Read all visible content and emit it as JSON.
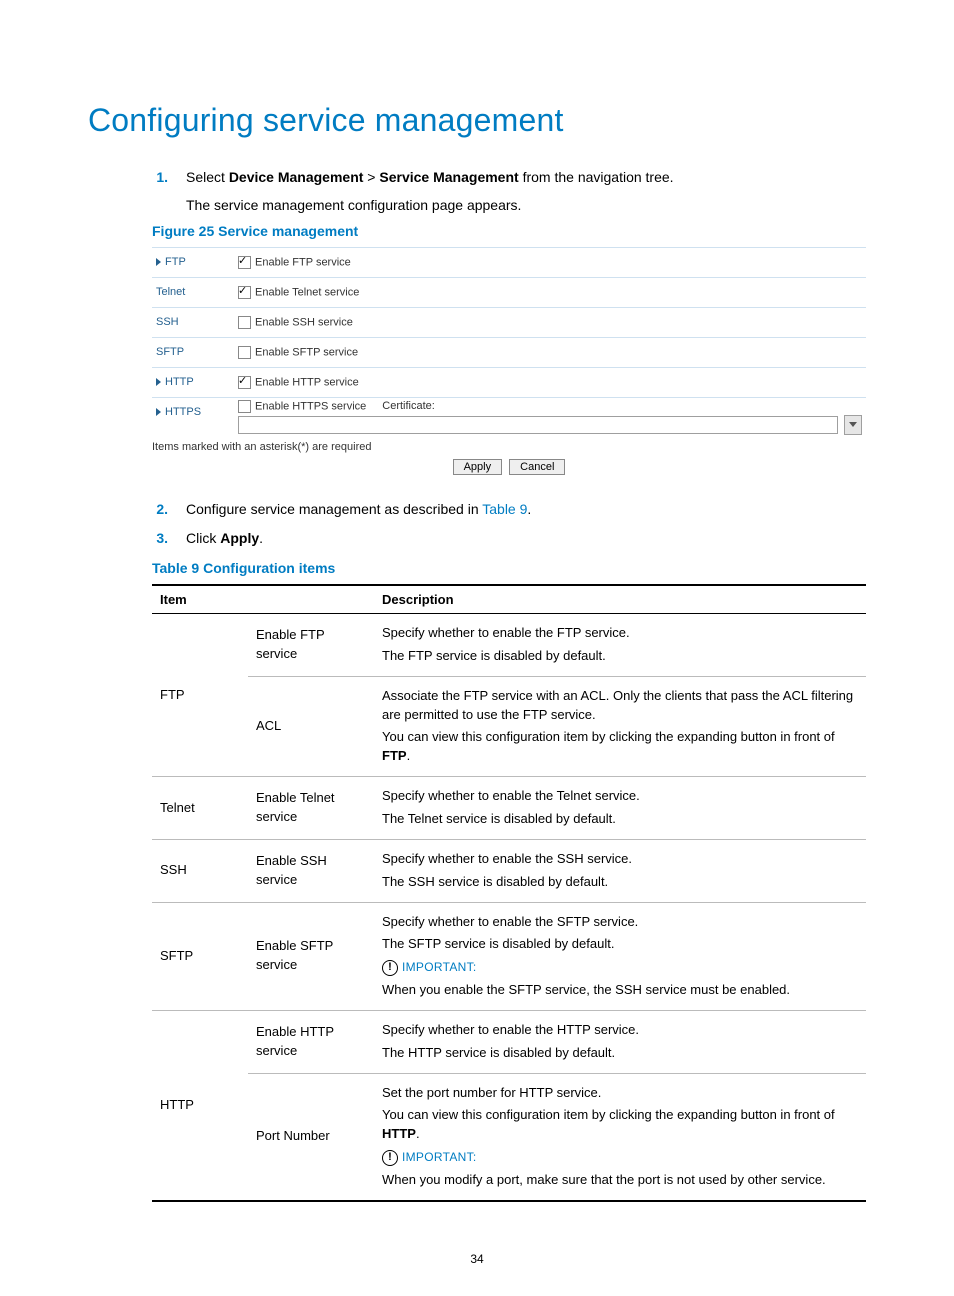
{
  "title": "Configuring service management",
  "steps": {
    "s1_num": "1.",
    "s1_a": "Select ",
    "s1_b": "Device Management",
    "s1_c": " > ",
    "s1_d": "Service Management",
    "s1_e": " from the navigation tree.",
    "s1_sub": "The service management configuration page appears.",
    "s2_num": "2.",
    "s2_a": "Configure service management as described in ",
    "s2_link": "Table 9",
    "s2_b": ".",
    "s3_num": "3.",
    "s3_a": "Click ",
    "s3_b": "Apply",
    "s3_c": "."
  },
  "figure_caption": "Figure 25 Service management",
  "panel": {
    "ftp_label": "FTP",
    "ftp_chk": "Enable FTP service",
    "telnet_label": "Telnet",
    "telnet_chk": "Enable Telnet service",
    "ssh_label": "SSH",
    "ssh_chk": "Enable SSH service",
    "sftp_label": "SFTP",
    "sftp_chk": "Enable SFTP service",
    "http_label": "HTTP",
    "http_chk": "Enable HTTP service",
    "https_label": "HTTPS",
    "https_chk": "Enable HTTPS service",
    "cert_label": "Certificate:",
    "required_note": "Items marked with an asterisk(*) are required",
    "apply": "Apply",
    "cancel": "Cancel"
  },
  "table_caption": "Table 9 Configuration items",
  "thead": {
    "c1": "Item",
    "c3": "Description"
  },
  "rows": {
    "ftp_group": "FTP",
    "ftp_enable_item": "Enable FTP service",
    "ftp_enable_d1": "Specify whether to enable the FTP service.",
    "ftp_enable_d2": "The FTP service is disabled by default.",
    "ftp_acl_item": "ACL",
    "ftp_acl_d1": "Associate the FTP service with an ACL. Only the clients that pass the ACL filtering are permitted to use the FTP service.",
    "ftp_acl_d2a": "You can view this configuration item by clicking the expanding button in front of ",
    "ftp_acl_d2b": "FTP",
    "ftp_acl_d2c": ".",
    "telnet_group": "Telnet",
    "telnet_item": "Enable Telnet service",
    "telnet_d1": "Specify whether to enable the Telnet service.",
    "telnet_d2": "The Telnet service is disabled by default.",
    "ssh_group": "SSH",
    "ssh_item": "Enable SSH service",
    "ssh_d1": "Specify whether to enable the SSH service.",
    "ssh_d2": "The SSH service is disabled by default.",
    "sftp_group": "SFTP",
    "sftp_item": "Enable SFTP service",
    "sftp_d1": "Specify whether to enable the SFTP service.",
    "sftp_d2": "The SFTP service is disabled by default.",
    "sftp_imp": "IMPORTANT:",
    "sftp_d3": "When you enable the SFTP service, the SSH service must be enabled.",
    "http_group": "HTTP",
    "http_enable_item": "Enable HTTP service",
    "http_enable_d1": "Specify whether to enable the HTTP service.",
    "http_enable_d2": "The HTTP service is disabled by default.",
    "http_port_item": "Port Number",
    "http_port_d1": "Set the port number for HTTP service.",
    "http_port_d2a": "You can view this configuration item by clicking the expanding button in front of ",
    "http_port_d2b": "HTTP",
    "http_port_d2c": ".",
    "http_imp": "IMPORTANT:",
    "http_port_d3": "When you modify a port, make sure that the port is not used by other service."
  },
  "pagenum": "34"
}
